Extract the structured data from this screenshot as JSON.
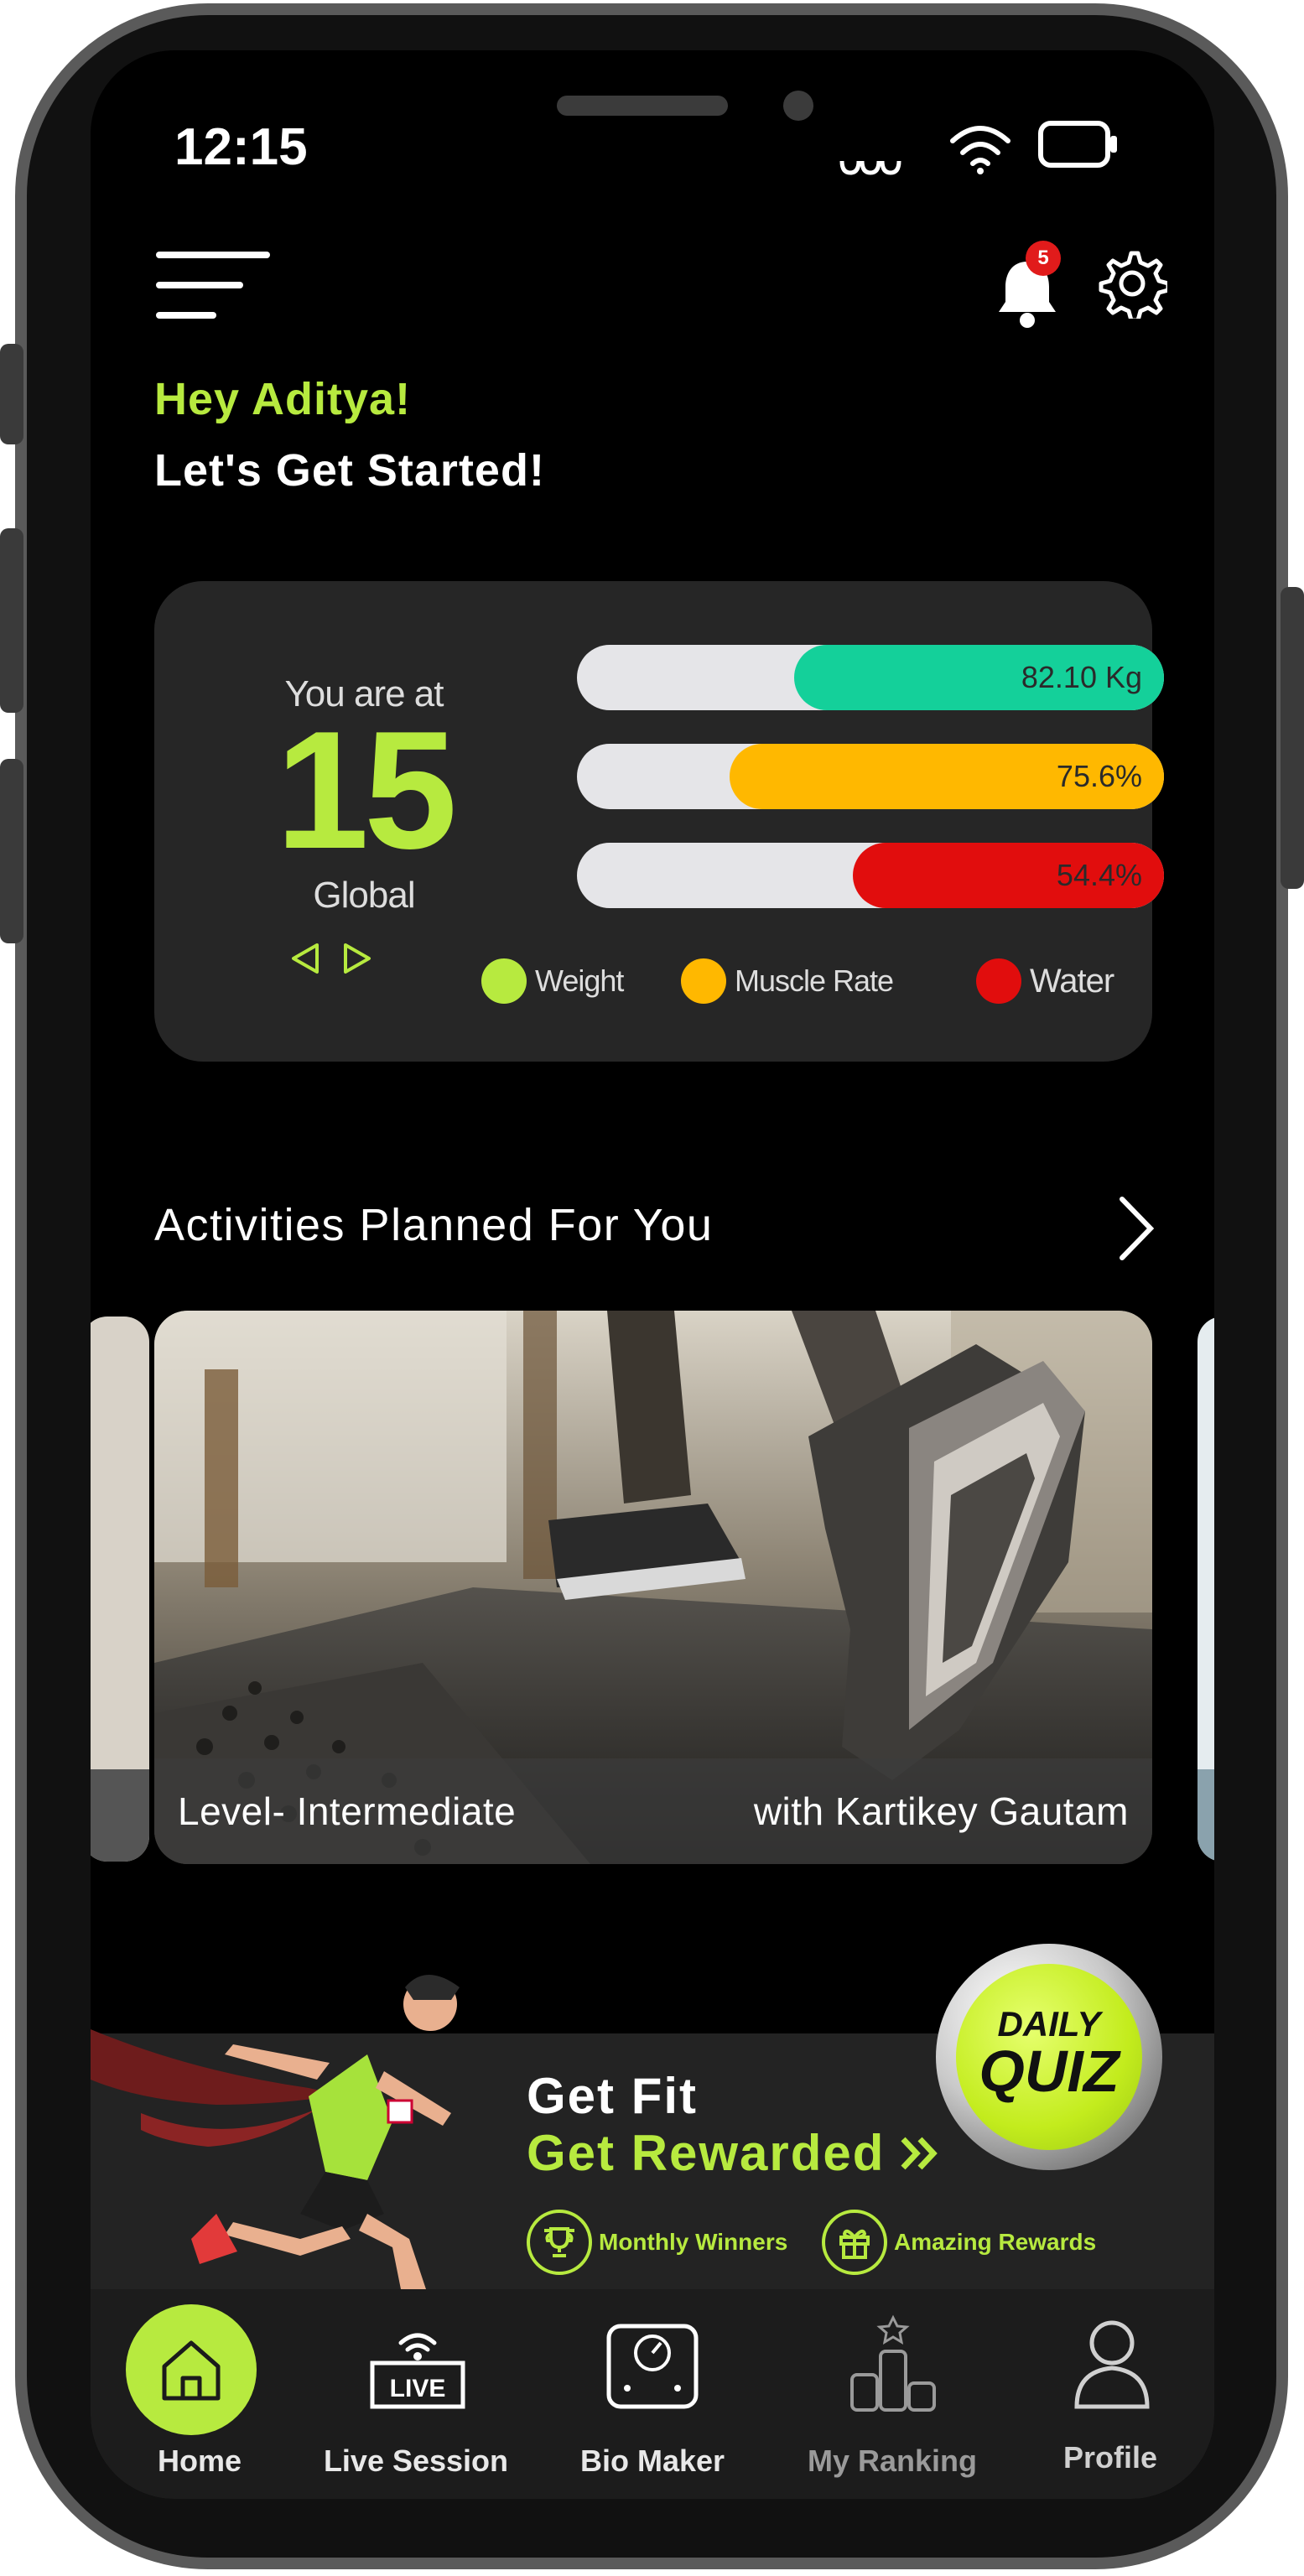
{
  "status_bar": {
    "time": "12:15"
  },
  "header": {
    "notification_count": "5"
  },
  "greeting": {
    "line1": "Hey Aditya!",
    "line2": "Let's Get Started!"
  },
  "stats": {
    "you_are_at": "You are at",
    "rank": "15",
    "scope": "Global",
    "bars": [
      {
        "metric": "Weight",
        "label": "82.10 Kg",
        "fill_fraction": 0.63,
        "color": "#14d09a"
      },
      {
        "metric": "Muscle Rate",
        "label": "75.6%",
        "fill_fraction": 0.74,
        "color": "#ffb800"
      },
      {
        "metric": "Water",
        "label": "54.4%",
        "fill_fraction": 0.53,
        "color": "#e10d0d"
      }
    ],
    "legend": [
      {
        "label": "Weight",
        "color": "#b7ea3f"
      },
      {
        "label": "Muscle Rate",
        "color": "#ffb800"
      },
      {
        "label": "Water",
        "color": "#e10d0d"
      }
    ]
  },
  "activities": {
    "title": "Activities Planned For You",
    "card": {
      "level": "Level- Intermediate",
      "trainer": "with Kartikey Gautam"
    }
  },
  "promo": {
    "line1": "Get Fit",
    "line2": "Get Rewarded",
    "badges": [
      "Monthly Winners",
      "Amazing Rewards"
    ],
    "quiz_top": "DAILY",
    "quiz_bottom": "QUIZ"
  },
  "nav": {
    "items": [
      {
        "label": "Home",
        "icon": "home-icon"
      },
      {
        "label": "Live Session",
        "icon": "live-icon"
      },
      {
        "label": "Bio Maker",
        "icon": "scale-icon"
      },
      {
        "label": "My Ranking",
        "icon": "podium-icon"
      },
      {
        "label": "Profile",
        "icon": "person-icon"
      }
    ]
  },
  "colors": {
    "accent": "#b7ea3f",
    "background": "#000000",
    "card": "#262626"
  }
}
